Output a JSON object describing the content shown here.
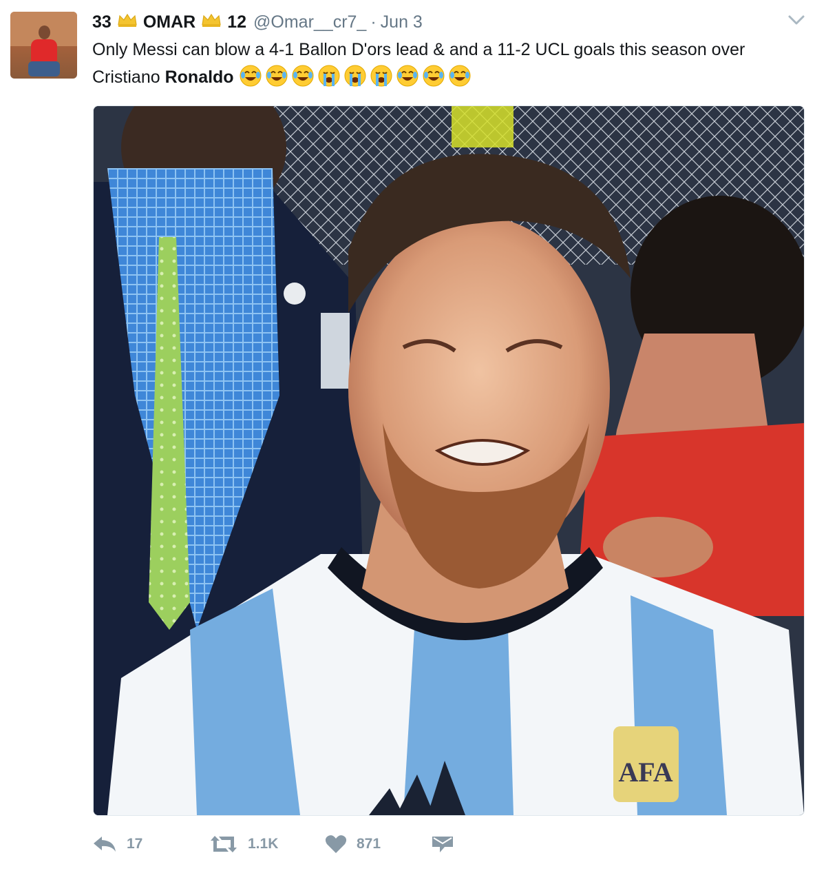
{
  "author": {
    "display_name_prefix": "33",
    "display_name": "OMAR",
    "display_name_suffix": "12",
    "handle": "@Omar__cr7_",
    "separator": "·",
    "date": "Jun 3",
    "avatar_icon": "user-avatar"
  },
  "tweet": {
    "text_line": "Only Messi can blow a 4-1 Ballon D'ors lead & and a 11-2 UCL goals this season over Cristiano ",
    "mention_bold": "Ronaldo",
    "emojis": [
      "joy",
      "joy",
      "joy",
      "sob",
      "sob",
      "sob",
      "joy",
      "joy",
      "joy"
    ],
    "media_icon": "photo-crying-footballer"
  },
  "actions": {
    "reply": {
      "icon": "reply-icon",
      "count": "17"
    },
    "retweet": {
      "icon": "retweet-icon",
      "count": "1.1K"
    },
    "like": {
      "icon": "heart-icon",
      "count": "871"
    },
    "dm": {
      "icon": "envelope-icon"
    }
  },
  "colors": {
    "text": "#14171a",
    "muted": "#657786",
    "action": "#8899a6",
    "crown": "#f4c430",
    "jersey_blue": "#74acdf"
  }
}
